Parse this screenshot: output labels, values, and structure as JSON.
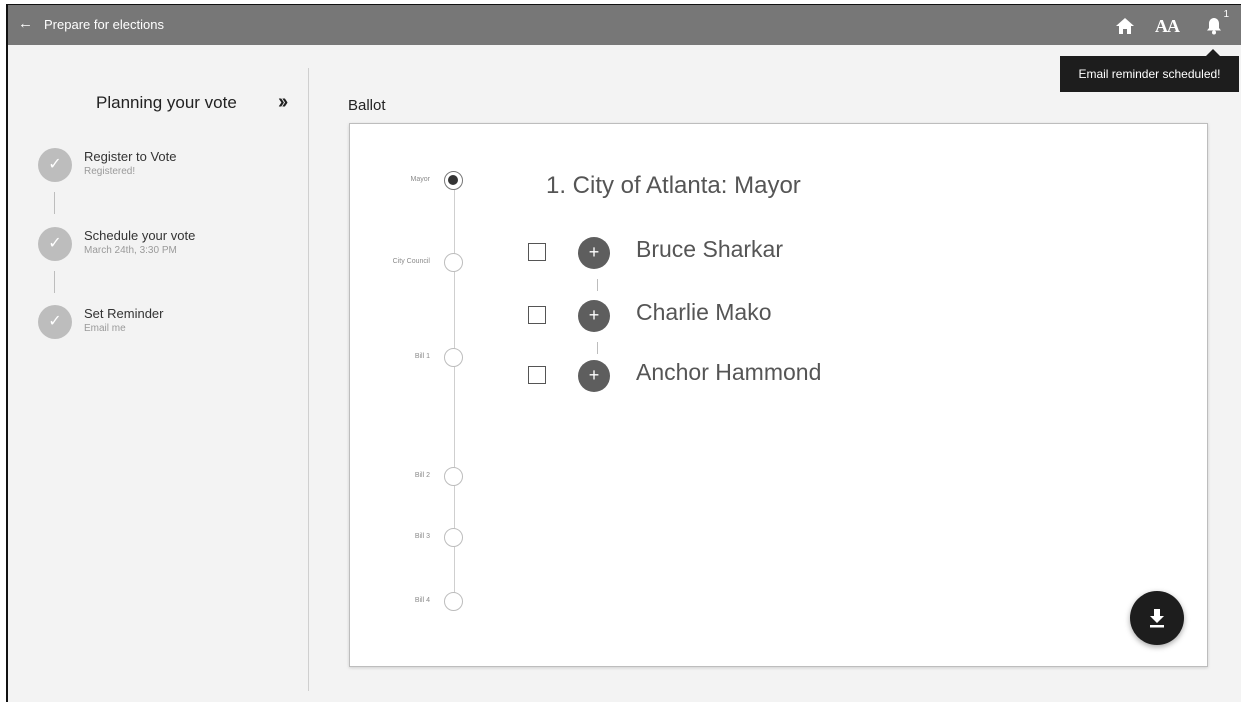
{
  "header": {
    "back_icon": "arrow-left-icon",
    "title": "Prepare for elections",
    "home_icon": "home-icon",
    "text_size_label": "AA",
    "notifications_icon": "bell-icon",
    "notification_count": "1"
  },
  "tooltip": {
    "text": "Email reminder scheduled!"
  },
  "sidebar": {
    "title": "Planning your vote",
    "collapse_icon": "double-chevron-right-icon",
    "steps": [
      {
        "label": "Register to Vote",
        "sub": "Registered!",
        "icon": "check-icon"
      },
      {
        "label": "Schedule your vote",
        "sub": "March 24th, 3:30 PM",
        "icon": "check-icon"
      },
      {
        "label": "Set Reminder",
        "sub": "Email me",
        "icon": "check-icon"
      }
    ]
  },
  "ballot": {
    "title": "Ballot",
    "timeline": [
      {
        "label": "Mayor",
        "active": true
      },
      {
        "label": "City Council",
        "active": false
      },
      {
        "label": "Bill 1",
        "active": false
      },
      {
        "label": "Bill 2",
        "active": false
      },
      {
        "label": "Bill 3",
        "active": false
      },
      {
        "label": "Bill 4",
        "active": false
      }
    ],
    "race_title": "1. City of Atlanta: Mayor",
    "candidates": [
      {
        "name": "Bruce Sharkar"
      },
      {
        "name": "Charlie Mako"
      },
      {
        "name": "Anchor Hammond"
      }
    ],
    "download_icon": "download-icon"
  },
  "colors": {
    "header_bg": "#777777",
    "tooltip_bg": "#1d1d1d",
    "step_done": "#bdbdbd",
    "candidate_button": "#5e5e5e",
    "fab_bg": "#1d1d1d"
  }
}
